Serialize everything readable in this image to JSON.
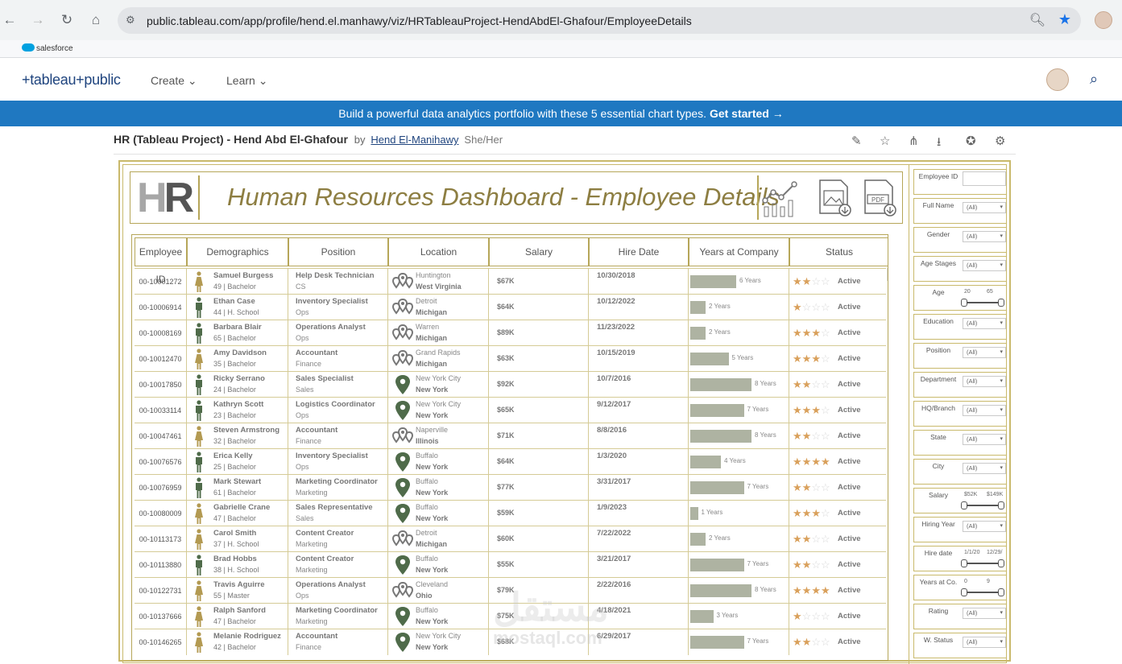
{
  "browser": {
    "url": "public.tableau.com/app/profile/hend.el.manhawy/viz/HRTableauProject-HendAbdEl-Ghafour/EmployeeDetails",
    "bookmark": "salesforce"
  },
  "site": {
    "logo": "+tableau+public",
    "menu_create": "Create",
    "menu_learn": "Learn",
    "banner_text": "Build a powerful data analytics portfolio with these 5 essential chart types.",
    "banner_cta": "Get started →"
  },
  "viz": {
    "title": "HR (Tableau Project) - Hend Abd El-Ghafour",
    "by": "by",
    "author": "Hend El-Manihawy",
    "pronouns": "She/Her"
  },
  "dashboard": {
    "logo_h": "H",
    "logo_r": "R",
    "title": "Human Resources Dashboard - Employee Details",
    "pdf_label": "PDF",
    "columns": [
      "Employee ID",
      "Demographics",
      "Position",
      "Location",
      "Salary",
      "Hire Date",
      "Years at Company",
      "Status"
    ],
    "rows": [
      {
        "id": "00-10001272",
        "name": "Samuel Burgess",
        "demo": "49 | Bachelor",
        "gender": "f",
        "title": "Help Desk Technician",
        "dept": "CS",
        "city": "Huntington",
        "state": "West Virginia",
        "hq": false,
        "salary": "$67K",
        "hire": "10/30/2018",
        "years": 6,
        "years_label": "6 Years",
        "rating": 2,
        "status": "Active"
      },
      {
        "id": "00-10006914",
        "name": "Ethan Case",
        "demo": "44 | H. School",
        "gender": "m",
        "title": "Inventory Specialist",
        "dept": "Ops",
        "city": "Detroit",
        "state": "Michigan",
        "hq": false,
        "salary": "$64K",
        "hire": "10/12/2022",
        "years": 2,
        "years_label": "2 Years",
        "rating": 1,
        "status": "Active"
      },
      {
        "id": "00-10008169",
        "name": "Barbara Blair",
        "demo": "65 | Bachelor",
        "gender": "m",
        "title": "Operations Analyst",
        "dept": "Ops",
        "city": "Warren",
        "state": "Michigan",
        "hq": false,
        "salary": "$89K",
        "hire": "11/23/2022",
        "years": 2,
        "years_label": "2 Years",
        "rating": 3,
        "status": "Active"
      },
      {
        "id": "00-10012470",
        "name": "Amy Davidson",
        "demo": "35 | Bachelor",
        "gender": "f",
        "title": "Accountant",
        "dept": "Finance",
        "city": "Grand Rapids",
        "state": "Michigan",
        "hq": false,
        "salary": "$63K",
        "hire": "10/15/2019",
        "years": 5,
        "years_label": "5 Years",
        "rating": 3,
        "status": "Active"
      },
      {
        "id": "00-10017850",
        "name": "Ricky Serrano",
        "demo": "24 | Bachelor",
        "gender": "m",
        "title": "Sales Specialist",
        "dept": "Sales",
        "city": "New York City",
        "state": "New York",
        "hq": true,
        "salary": "$92K",
        "hire": "10/7/2016",
        "years": 8,
        "years_label": "8 Years",
        "rating": 2,
        "status": "Active"
      },
      {
        "id": "00-10033114",
        "name": "Kathryn Scott",
        "demo": "23 | Bachelor",
        "gender": "m",
        "title": "Logistics Coordinator",
        "dept": "Ops",
        "city": "New York City",
        "state": "New York",
        "hq": true,
        "salary": "$65K",
        "hire": "9/12/2017",
        "years": 7,
        "years_label": "7 Years",
        "rating": 3,
        "status": "Active"
      },
      {
        "id": "00-10047461",
        "name": "Steven Armstrong",
        "demo": "32 | Bachelor",
        "gender": "f",
        "title": "Accountant",
        "dept": "Finance",
        "city": "Naperville",
        "state": "Illinois",
        "hq": false,
        "salary": "$71K",
        "hire": "8/8/2016",
        "years": 8,
        "years_label": "8 Years",
        "rating": 2,
        "status": "Active"
      },
      {
        "id": "00-10076576",
        "name": "Erica Kelly",
        "demo": "25 | Bachelor",
        "gender": "m",
        "title": "Inventory Specialist",
        "dept": "Ops",
        "city": "Buffalo",
        "state": "New York",
        "hq": true,
        "salary": "$64K",
        "hire": "1/3/2020",
        "years": 4,
        "years_label": "4 Years",
        "rating": 4,
        "status": "Active"
      },
      {
        "id": "00-10076959",
        "name": "Mark Stewart",
        "demo": "61 | Bachelor",
        "gender": "m",
        "title": "Marketing Coordinator",
        "dept": "Marketing",
        "city": "Buffalo",
        "state": "New York",
        "hq": true,
        "salary": "$77K",
        "hire": "3/31/2017",
        "years": 7,
        "years_label": "7 Years",
        "rating": 2,
        "status": "Active"
      },
      {
        "id": "00-10080009",
        "name": "Gabrielle Crane",
        "demo": "47 | Bachelor",
        "gender": "f",
        "title": "Sales Representative",
        "dept": "Sales",
        "city": "Buffalo",
        "state": "New York",
        "hq": true,
        "salary": "$59K",
        "hire": "1/9/2023",
        "years": 1,
        "years_label": "1 Years",
        "rating": 3,
        "status": "Active"
      },
      {
        "id": "00-10113173",
        "name": "Carol Smith",
        "demo": "37 | H. School",
        "gender": "f",
        "title": "Content Creator",
        "dept": "Marketing",
        "city": "Detroit",
        "state": "Michigan",
        "hq": false,
        "salary": "$60K",
        "hire": "7/22/2022",
        "years": 2,
        "years_label": "2 Years",
        "rating": 2,
        "status": "Active"
      },
      {
        "id": "00-10113880",
        "name": "Brad Hobbs",
        "demo": "38 | H. School",
        "gender": "m",
        "title": "Content Creator",
        "dept": "Marketing",
        "city": "Buffalo",
        "state": "New York",
        "hq": true,
        "salary": "$55K",
        "hire": "3/21/2017",
        "years": 7,
        "years_label": "7 Years",
        "rating": 2,
        "status": "Active"
      },
      {
        "id": "00-10122731",
        "name": "Travis Aguirre",
        "demo": "55 | Master",
        "gender": "f",
        "title": "Operations Analyst",
        "dept": "Ops",
        "city": "Cleveland",
        "state": "Ohio",
        "hq": false,
        "salary": "$79K",
        "hire": "2/22/2016",
        "years": 8,
        "years_label": "8 Years",
        "rating": 4,
        "status": "Active"
      },
      {
        "id": "00-10137666",
        "name": "Ralph Sanford",
        "demo": "47 | Bachelor",
        "gender": "f",
        "title": "Marketing Coordinator",
        "dept": "Marketing",
        "city": "Buffalo",
        "state": "New York",
        "hq": true,
        "salary": "$75K",
        "hire": "4/18/2021",
        "years": 3,
        "years_label": "3 Years",
        "rating": 1,
        "status": "Active"
      },
      {
        "id": "00-10146265",
        "name": "Melanie Rodriguez",
        "demo": "42 | Bachelor",
        "gender": "f",
        "title": "Accountant",
        "dept": "Finance",
        "city": "New York City",
        "state": "New York",
        "hq": true,
        "salary": "$68K",
        "hire": "6/29/2017",
        "years": 7,
        "years_label": "7 Years",
        "rating": 2,
        "status": "Active"
      }
    ]
  },
  "filters": [
    {
      "label": "Employee ID",
      "kind": "input",
      "value": ""
    },
    {
      "label": "Full Name",
      "kind": "select",
      "value": "(All)"
    },
    {
      "label": "Gender",
      "kind": "select",
      "value": "(All)"
    },
    {
      "label": "Age Stages",
      "kind": "select",
      "value": "(All)"
    },
    {
      "label": "Age",
      "kind": "range",
      "min": "20",
      "max": "65"
    },
    {
      "label": "Education",
      "kind": "select",
      "value": "(All)"
    },
    {
      "label": "Position",
      "kind": "select",
      "value": "(All)"
    },
    {
      "label": "Department",
      "kind": "select",
      "value": "(All)"
    },
    {
      "label": "HQ/Branch",
      "kind": "select",
      "value": "(All)"
    },
    {
      "label": "State",
      "kind": "select",
      "value": "(All)"
    },
    {
      "label": "City",
      "kind": "select",
      "value": "(All)"
    },
    {
      "label": "Salary",
      "kind": "range",
      "min": "$52K",
      "max": "$149K"
    },
    {
      "label": "Hiring Year",
      "kind": "select",
      "value": "(All)"
    },
    {
      "label": "Hire date",
      "kind": "range",
      "min": "1/1/20",
      "max": "12/29/"
    },
    {
      "label": "Years at Co.",
      "kind": "range",
      "min": "0",
      "max": "9"
    },
    {
      "label": "Rating",
      "kind": "select",
      "value": "(All)"
    },
    {
      "label": "W. Status",
      "kind": "select",
      "value": "(All)"
    }
  ],
  "watermark": {
    "arabic": "مستقل",
    "latin": "mostaql.com"
  },
  "colors": {
    "accent": "#c9b96b",
    "banner": "#1f78c1",
    "male_icon": "#4f6b4a",
    "female_icon": "#b39a52",
    "bar": "#aeb3a2",
    "star_on": "#d9a05b"
  }
}
